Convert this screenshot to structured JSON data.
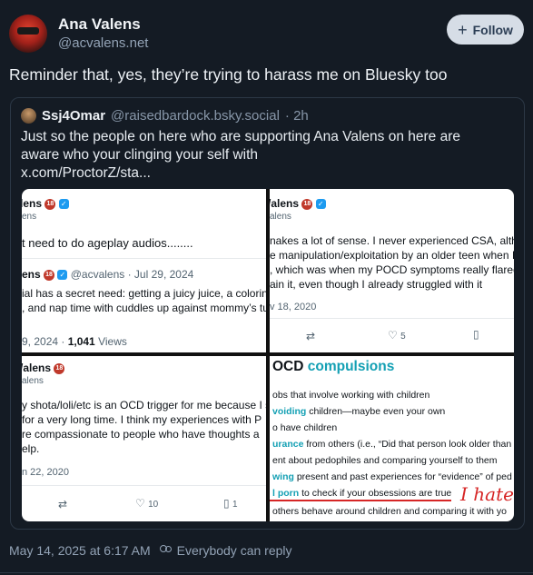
{
  "post": {
    "author_name": "Ana Valens",
    "author_handle": "@acvalens.net",
    "follow_label": "Follow",
    "text": "Reminder that, yes, they’re trying to harass me on Bluesky too",
    "timestamp": "May 14, 2025 at 6:17 AM",
    "reply_setting": "Everybody can reply"
  },
  "quote": {
    "author_name": "Ssj4Omar",
    "author_handle": "@raisedbardock.bsky.social",
    "age": "· 2h",
    "text": "Just so the people on here who are supporting Ana Valens on here are aware who your clinging your self with",
    "link": "x.com/ProctorZ/sta..."
  },
  "screens": {
    "p1": {
      "name1": "lens",
      "handle1": "ens",
      "text1": "t need to do ageplay audios........",
      "name2": "ens",
      "handle2": "@acvalens · Jul 29, 2024",
      "line2a": "ial has a secret need: getting a juicy juice, a coloring",
      "line2b": ", and nap time with cuddles up against mommy’s tu",
      "date": "9, 2024 · ",
      "views_num": "1,041",
      "views_label": " Views"
    },
    "p2": {
      "name": "/alens",
      "handle": "alens",
      "line1": "nakes a lot of sense. I never experienced CSA, altho",
      "line2": "e manipulation/exploitation by an older teen when I",
      "line3": ", which was when my POCD symptoms really flared",
      "line4": "ain it, even though I already struggled with it",
      "date": "v 18, 2020",
      "likes": "5"
    },
    "p3": {
      "name": "/alens",
      "handle": "alens",
      "line1": "y shota/loli/etc is an OCD trigger for me because I s",
      "line2": "for a very long time. I think my experiences with P",
      "line3": "re compassionate to people who have thoughts a",
      "line4": "elp.",
      "date": "n 22, 2020",
      "likes": "10",
      "bookmarks": "1"
    },
    "p4": {
      "title_a": "OCD ",
      "title_b": "compulsions",
      "l1": "obs that involve working with children",
      "l2_teal": "voiding",
      "l2_rest": " children—maybe even your own",
      "l3": "o have children",
      "l4_teal": "urance",
      "l4_rest": " from others (i.e., “Did that person look older than",
      "l5": "ent about pedophiles and comparing yourself to them",
      "l6_teal": "wing",
      "l6_rest": " present and past experiences for “evidence” of ped",
      "l7_teal": "l porn",
      "l7_rest": " to check if your obsessions are true",
      "l8": "others behave around children and comparing it with yo",
      "handwriting": "I hate"
    }
  }
}
